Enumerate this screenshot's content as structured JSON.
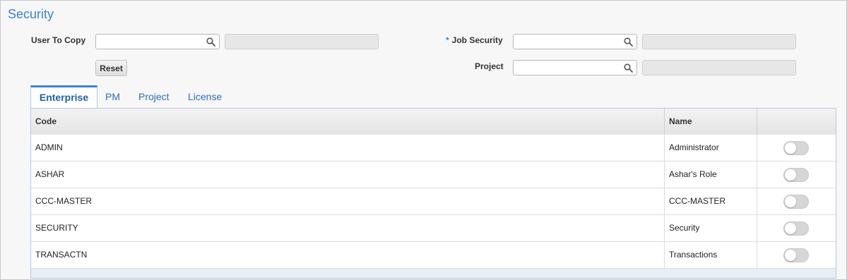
{
  "page": {
    "title": "Security"
  },
  "form": {
    "user_to_copy": {
      "label": "User To Copy",
      "value": "",
      "description": ""
    },
    "job_security": {
      "required_mark": "*",
      "label": "Job Security",
      "value": "",
      "description": ""
    },
    "project": {
      "label": "Project",
      "value": "",
      "description": ""
    },
    "reset_label": "Reset"
  },
  "tabs": [
    {
      "label": "Enterprise",
      "active": true
    },
    {
      "label": "PM",
      "active": false
    },
    {
      "label": "Project",
      "active": false
    },
    {
      "label": "License",
      "active": false
    }
  ],
  "grid": {
    "columns": {
      "code": "Code",
      "name": "Name",
      "toggle": ""
    },
    "rows": [
      {
        "code": "ADMIN",
        "name": "Administrator",
        "enabled": false
      },
      {
        "code": "ASHAR",
        "name": "Ashar's Role",
        "enabled": false
      },
      {
        "code": "CCC-MASTER",
        "name": "CCC-MASTER",
        "enabled": false
      },
      {
        "code": "SECURITY",
        "name": "Security",
        "enabled": false
      },
      {
        "code": "TRANSACTN",
        "name": "Transactions",
        "enabled": false
      }
    ]
  },
  "icons": {
    "lookup": "search-icon",
    "toggle": "toggle-switch-off"
  },
  "colors": {
    "accent": "#3b82d6",
    "tab_text": "#2d6fb8"
  }
}
